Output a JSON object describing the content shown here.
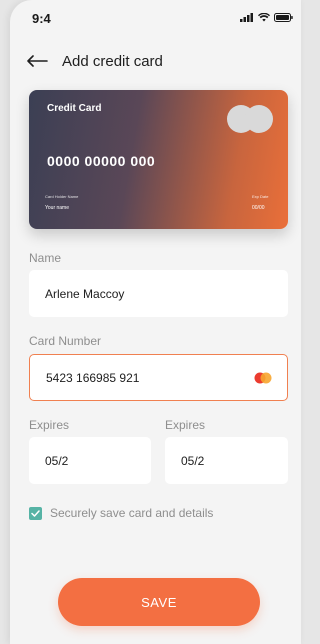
{
  "status": {
    "time": "9:4"
  },
  "header": {
    "title": "Add credit card"
  },
  "card": {
    "title": "Credit Card",
    "number": "0000 00000  000",
    "holder_label": "Card Holder Name",
    "holder_value": "Your name",
    "expiry_label": "Exp Date",
    "expiry_value": "00/00",
    "gradient_colors": [
      "#3b3f54",
      "#ea6f39"
    ]
  },
  "form": {
    "name": {
      "label": "Name",
      "value": "Arlene Maccoy"
    },
    "card_number": {
      "label": "Card Number",
      "value": "5423 166985 921",
      "brand_icon": "mastercard-icon"
    },
    "expires_month": {
      "label": "Expires",
      "value": "05/2"
    },
    "expires_year": {
      "label": "Expires",
      "value": "05/2"
    }
  },
  "save_card": {
    "label": "Securely save card and details",
    "checked": true,
    "color": "#56b3a5"
  },
  "save_button": {
    "label": "SAVE",
    "color": "#f36f42"
  }
}
